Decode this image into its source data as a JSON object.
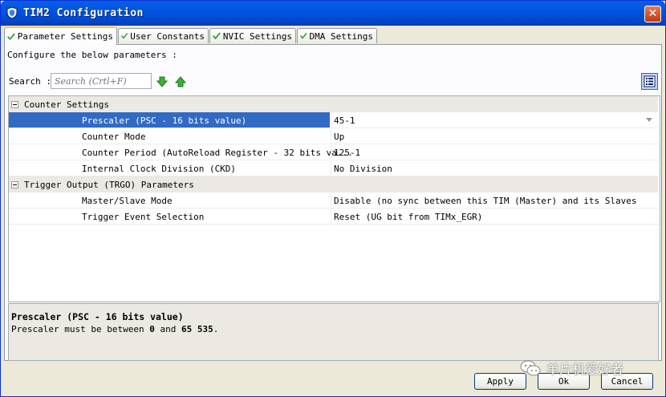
{
  "window": {
    "title": "TIM2 Configuration",
    "close_glyph": "✕"
  },
  "tabs": [
    {
      "label": "Parameter Settings",
      "active": true,
      "icon": "check-icon"
    },
    {
      "label": "User Constants",
      "active": false,
      "icon": "check-icon"
    },
    {
      "label": "NVIC Settings",
      "active": false,
      "icon": "check-icon"
    },
    {
      "label": "DMA Settings",
      "active": false,
      "icon": "check-icon"
    }
  ],
  "panel": {
    "instruction": "Configure the below parameters :",
    "search_label": "Search :",
    "search_placeholder": "Search (Crtl+F)"
  },
  "groups": [
    {
      "label": "Counter Settings",
      "params": [
        {
          "name": "Prescaler (PSC - 16 bits value)",
          "value": "45-1",
          "selected": true
        },
        {
          "name": "Counter Mode",
          "value": "Up"
        },
        {
          "name": "Counter Period (AutoReload Register - 32 bits va...",
          "value": "125-1"
        },
        {
          "name": "Internal Clock Division (CKD)",
          "value": "No Division"
        }
      ]
    },
    {
      "label": "Trigger Output (TRGO) Parameters",
      "params": [
        {
          "name": "Master/Slave Mode",
          "value": "Disable (no sync between this TIM (Master) and its Slaves"
        },
        {
          "name": "Trigger Event Selection",
          "value": "Reset (UG bit from TIMx_EGR)"
        }
      ]
    }
  ],
  "description": {
    "title": "Prescaler (PSC - 16 bits value)",
    "text_prefix": "Prescaler must be between",
    "min": "0",
    "and": "and",
    "max": "65 535",
    "suffix": "."
  },
  "buttons": {
    "apply": "Apply",
    "ok": "Ok",
    "cancel": "Cancel"
  },
  "watermark": {
    "text": "单片机爱好者"
  },
  "colors": {
    "selection": "#316ac5",
    "titlebar": "#0054e3",
    "arrow_green": "#2ca02c"
  }
}
